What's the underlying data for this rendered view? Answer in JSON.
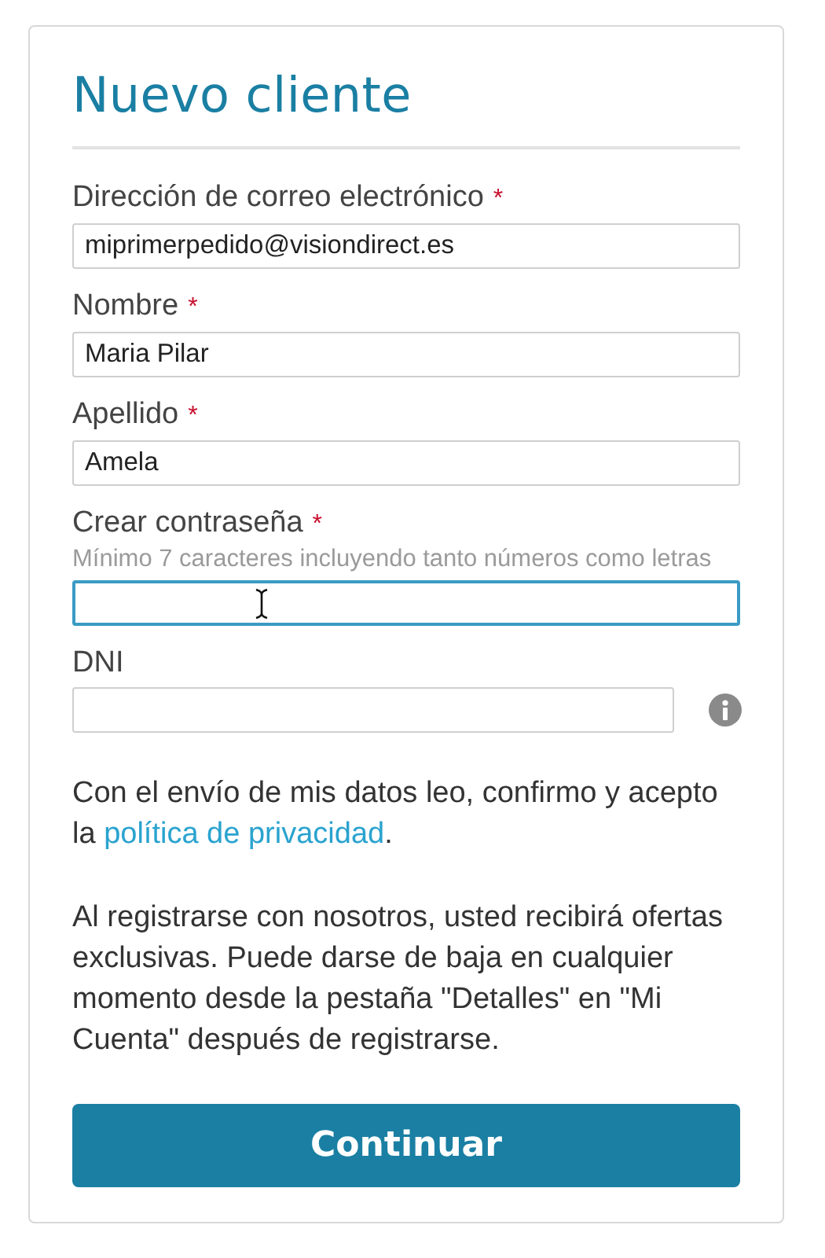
{
  "title": "Nuevo cliente",
  "required_mark": "*",
  "fields": [
    {
      "label": "Dirección de correo electrónico",
      "required": true,
      "value": "miprimerpedido@visiondirect.es",
      "focused": false,
      "info": false
    },
    {
      "label": "Nombre",
      "required": true,
      "value": "Maria Pilar",
      "focused": false,
      "info": false
    },
    {
      "label": "Apellido",
      "required": true,
      "value": "Amela",
      "focused": false,
      "info": false
    },
    {
      "label": "Crear contraseña",
      "required": true,
      "hint": "Mínimo 7 caracteres incluyendo tanto números como letras",
      "focused": true,
      "info": false
    },
    {
      "label": "DNI",
      "required": false,
      "focused": false,
      "info": true
    }
  ],
  "consent": {
    "text": "Con el envío de mis datos leo, confirmo y acepto la ",
    "link": "política de privacidad",
    "after": "."
  },
  "notice": "Al registrarse con nosotros, usted recibirá ofertas exclusivas. Puede darse de baja en cualquier momento desde la pestaña \"Detalles\" en \"Mi Cuenta\" después de registrarse.",
  "button": "Continuar"
}
